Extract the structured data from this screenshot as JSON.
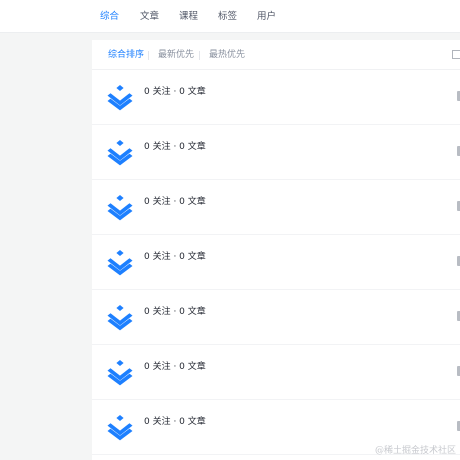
{
  "nav": {
    "tabs": [
      {
        "label": "综合",
        "active": true
      },
      {
        "label": "文章",
        "active": false
      },
      {
        "label": "课程",
        "active": false
      },
      {
        "label": "标签",
        "active": false
      },
      {
        "label": "用户",
        "active": false
      }
    ]
  },
  "sort": {
    "options": [
      {
        "label": "综合排序",
        "active": true
      },
      {
        "label": "最新优先",
        "active": false
      },
      {
        "label": "最热优先",
        "active": false
      }
    ]
  },
  "results": [
    {
      "icon": "juejin-logo-icon",
      "stats": "0 关注 · 0 文章"
    },
    {
      "icon": "juejin-logo-icon",
      "stats": "0 关注 · 0 文章"
    },
    {
      "icon": "juejin-logo-icon",
      "stats": "0 关注 · 0 文章"
    },
    {
      "icon": "juejin-logo-icon",
      "stats": "0 关注 · 0 文章"
    },
    {
      "icon": "juejin-logo-icon",
      "stats": "0 关注 · 0 文章"
    },
    {
      "icon": "juejin-logo-icon",
      "stats": "0 关注 · 0 文章"
    },
    {
      "icon": "juejin-logo-icon",
      "stats": "0 关注 · 0 文章"
    }
  ],
  "watermark": "@稀土掘金技术社区",
  "colors": {
    "accent": "#1e80ff",
    "background": "#f4f5f5",
    "panel": "#ffffff"
  }
}
